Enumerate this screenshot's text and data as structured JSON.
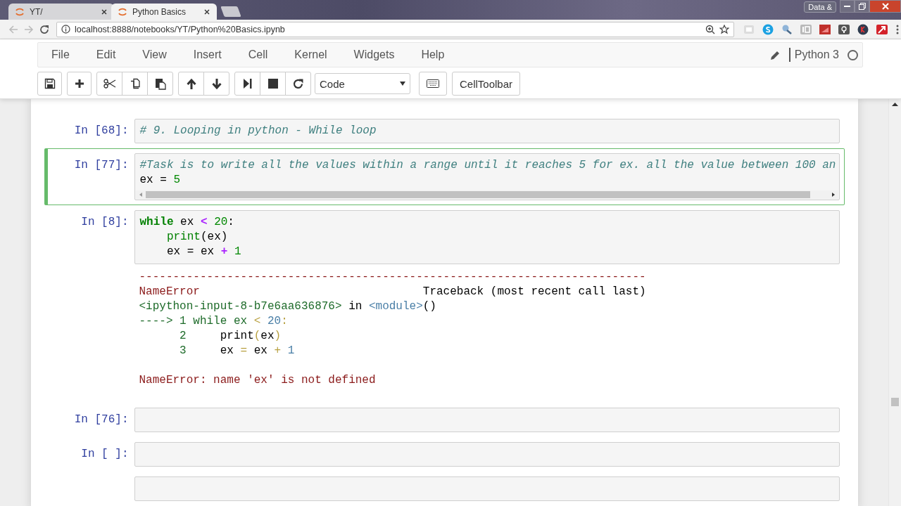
{
  "browser": {
    "tabs": [
      {
        "title": "YT/",
        "selected": false
      },
      {
        "title": "Python Basics",
        "selected": true
      }
    ],
    "profile_button": "Data &",
    "url": "localhost:8888/notebooks/YT/Python%20Basics.ipynb"
  },
  "menubar": {
    "menus": [
      "File",
      "Edit",
      "View",
      "Insert",
      "Cell",
      "Kernel",
      "Widgets",
      "Help"
    ],
    "edit_mode": true,
    "kernel_name": "Python 3",
    "kernel_busy": false
  },
  "toolbar": {
    "cell_type": "Code",
    "cell_toolbar_button": "CellToolbar"
  },
  "cells": [
    {
      "prompt": "In [68]:",
      "selected": false,
      "lines": [
        [
          {
            "kind": "comment",
            "text": "# 9. Looping in python - While loop"
          }
        ]
      ]
    },
    {
      "prompt": "In [77]:",
      "selected": true,
      "lines": [
        [
          {
            "kind": "comment",
            "text": "#Task is to write all the values within a range until it reaches 5 for ex. all the value between 100 an"
          }
        ],
        [
          {
            "kind": "plain",
            "text": "ex = "
          },
          {
            "kind": "number",
            "text": "5"
          }
        ]
      ]
    },
    {
      "prompt": "In [8]:",
      "selected": false,
      "lines": [
        [
          {
            "kind": "keyword",
            "text": "while"
          },
          {
            "kind": "plain",
            "text": " ex "
          },
          {
            "kind": "operator",
            "text": "<"
          },
          {
            "kind": "number",
            "text": " 20"
          },
          {
            "kind": "plain",
            "text": ":"
          }
        ],
        [
          {
            "kind": "builtin",
            "text": "    print"
          },
          {
            "kind": "plain",
            "text": "(ex)"
          }
        ],
        [
          {
            "kind": "plain",
            "text": "    ex = ex "
          },
          {
            "kind": "operator",
            "text": "+"
          },
          {
            "kind": "number",
            "text": " 1"
          }
        ]
      ],
      "output": [
        {
          "lines": [
            [
              {
                "kind": "red",
                "text": "---------------------------------------------------------------------------"
              }
            ],
            [
              {
                "kind": "red",
                "text": "NameError"
              },
              {
                "kind": "plain",
                "text": "                                 Traceback (most recent call last)"
              }
            ],
            [
              {
                "kind": "green",
                "text": "<ipython-input-8-b7e6aa636876>"
              },
              {
                "kind": "plain",
                "text": " in "
              },
              {
                "kind": "cyan",
                "text": "<module>"
              },
              {
                "kind": "plain",
                "text": "()"
              }
            ],
            [
              {
                "kind": "green",
                "text": "----> 1 while ex "
              },
              {
                "kind": "yellow",
                "text": "<"
              },
              {
                "kind": "cyan",
                "text": " 20"
              },
              {
                "kind": "yellow",
                "text": ":"
              }
            ],
            [
              {
                "kind": "green",
                "text": "      2"
              },
              {
                "kind": "plain",
                "text": "     print"
              },
              {
                "kind": "yellow",
                "text": "("
              },
              {
                "kind": "plain",
                "text": "ex"
              },
              {
                "kind": "yellow",
                "text": ")"
              }
            ],
            [
              {
                "kind": "green",
                "text": "      3"
              },
              {
                "kind": "plain",
                "text": "     ex "
              },
              {
                "kind": "yellow",
                "text": "="
              },
              {
                "kind": "plain",
                "text": " ex "
              },
              {
                "kind": "yellow",
                "text": "+"
              },
              {
                "kind": "cyan",
                "text": " 1"
              }
            ]
          ]
        },
        {
          "lines": [
            [
              {
                "kind": "red",
                "text": "NameError: name 'ex' is not defined"
              }
            ]
          ]
        }
      ]
    },
    {
      "prompt": "In [76]:",
      "selected": false
    },
    {
      "prompt": "In [ ]:",
      "selected": false
    },
    {
      "selected": false
    }
  ]
}
